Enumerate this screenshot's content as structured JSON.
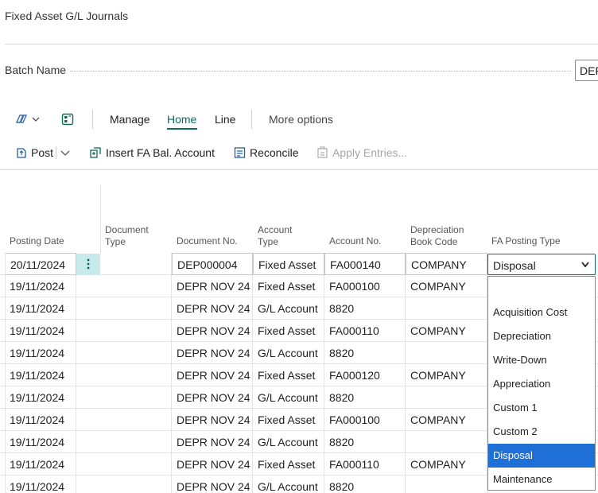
{
  "page": {
    "title": "Fixed Asset G/L Journals"
  },
  "batch": {
    "label": "Batch Name",
    "value": "DEFAULT"
  },
  "actionbar": {
    "tabs": [
      "Manage",
      "Home",
      "Line",
      "More options"
    ],
    "active_tab": "Home"
  },
  "toolbar": {
    "post": "Post",
    "insert_bal": "Insert FA Bal. Account",
    "reconcile": "Reconcile",
    "apply_entries": "Apply Entries..."
  },
  "columns": {
    "posting_date": "Posting Date",
    "document_type_1": "Document",
    "document_type_2": "Type",
    "document_no": "Document No.",
    "account_type_1": "Account",
    "account_type_2": "Type",
    "account_no": "Account No.",
    "depr_book_1": "Depreciation",
    "depr_book_2": "Book Code",
    "fa_posting_type": "FA Posting Type"
  },
  "rows": [
    {
      "date": "20/11/2024",
      "doc_no": "DEP000004",
      "acc_type": "Fixed Asset",
      "acc_no": "FA000140",
      "book": "COMPANY"
    },
    {
      "date": "19/11/2024",
      "doc_no": "DEPR NOV 24",
      "acc_type": "Fixed Asset",
      "acc_no": "FA000100",
      "book": "COMPANY"
    },
    {
      "date": "19/11/2024",
      "doc_no": "DEPR NOV 24",
      "acc_type": "G/L Account",
      "acc_no": "8820",
      "book": ""
    },
    {
      "date": "19/11/2024",
      "doc_no": "DEPR NOV 24",
      "acc_type": "Fixed Asset",
      "acc_no": "FA000110",
      "book": "COMPANY"
    },
    {
      "date": "19/11/2024",
      "doc_no": "DEPR NOV 24",
      "acc_type": "G/L Account",
      "acc_no": "8820",
      "book": ""
    },
    {
      "date": "19/11/2024",
      "doc_no": "DEPR NOV 24",
      "acc_type": "Fixed Asset",
      "acc_no": "FA000120",
      "book": "COMPANY"
    },
    {
      "date": "19/11/2024",
      "doc_no": "DEPR NOV 24",
      "acc_type": "G/L Account",
      "acc_no": "8820",
      "book": ""
    },
    {
      "date": "19/11/2024",
      "doc_no": "DEPR NOV 24",
      "acc_type": "Fixed Asset",
      "acc_no": "FA000100",
      "book": "COMPANY"
    },
    {
      "date": "19/11/2024",
      "doc_no": "DEPR NOV 24",
      "acc_type": "G/L Account",
      "acc_no": "8820",
      "book": ""
    },
    {
      "date": "19/11/2024",
      "doc_no": "DEPR NOV 24",
      "acc_type": "Fixed Asset",
      "acc_no": "FA000110",
      "book": "COMPANY"
    },
    {
      "date": "19/11/2024",
      "doc_no": "DEPR NOV 24",
      "acc_type": "G/L Account",
      "acc_no": "8820",
      "book": ""
    }
  ],
  "fa_posting": {
    "selected": "Disposal",
    "options": [
      "",
      "Acquisition Cost",
      "Depreciation",
      "Write-Down",
      "Appreciation",
      "Custom 1",
      "Custom 2",
      "Disposal",
      "Maintenance"
    ]
  },
  "colors": {
    "accent": "#0f6a5a",
    "selection": "#1e6fd6",
    "row_menu": "#c7eaed"
  }
}
